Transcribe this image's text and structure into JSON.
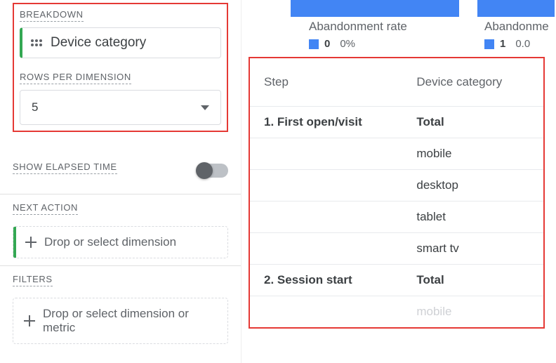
{
  "sidebar": {
    "breakdown_label": "BREAKDOWN",
    "breakdown_chip": "Device category",
    "rows_label": "ROWS PER DIMENSION",
    "rows_value": "5",
    "elapsed_label": "SHOW ELAPSED TIME",
    "elapsed_on": false,
    "next_action_label": "NEXT ACTION",
    "next_action_placeholder": "Drop or select dimension",
    "filters_label": "FILTERS",
    "filters_placeholder": "Drop or select dimension or metric"
  },
  "charts": {
    "items": [
      {
        "label": "Abandonment rate",
        "value": "0",
        "pct": "0%"
      },
      {
        "label": "Abandonme",
        "value": "1",
        "pct": "0.0"
      }
    ]
  },
  "table": {
    "col_step": "Step",
    "col_device": "Device category",
    "rows": [
      {
        "step": "1. First open/visit",
        "device": "Total",
        "bold": true
      },
      {
        "step": "",
        "device": "mobile"
      },
      {
        "step": "",
        "device": "desktop"
      },
      {
        "step": "",
        "device": "tablet"
      },
      {
        "step": "",
        "device": "smart tv"
      },
      {
        "step": "2. Session start",
        "device": "Total",
        "bold": true
      },
      {
        "step": "",
        "device": "mobile",
        "fade": true
      }
    ]
  }
}
